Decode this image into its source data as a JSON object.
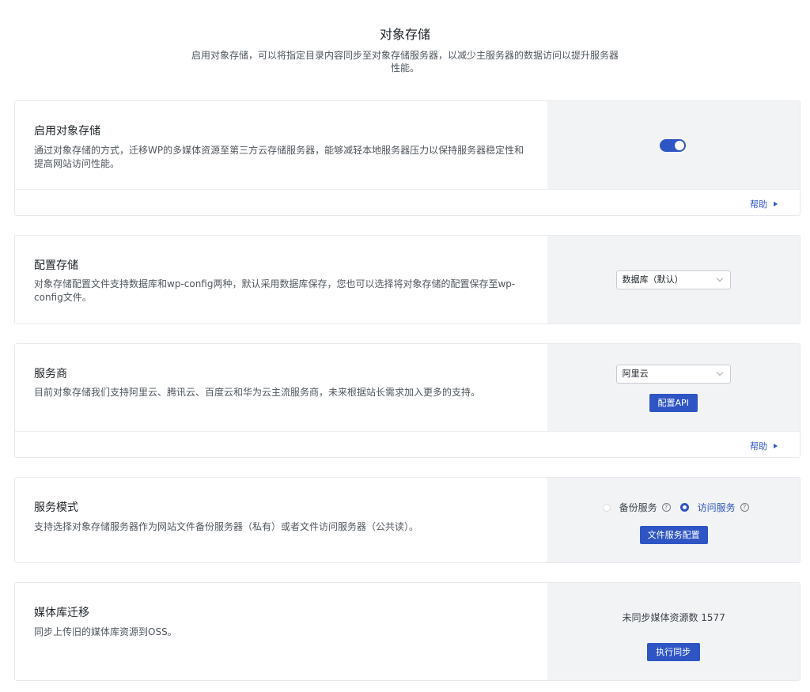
{
  "header": {
    "title": "对象存储",
    "description": "启用对象存储，可以将指定目录内容同步至对象存储服务器，以减少主服务器的数据访问以提升服务器性能。"
  },
  "sections": {
    "enable": {
      "title": "启用对象存储",
      "description": "通过对象存储的方式，迁移WP的多媒体资源至第三方云存储服务器，能够减轻本地服务器压力以保持服务器稳定性和提高网站访问性能。",
      "toggle_on": true,
      "help_label": "帮助"
    },
    "config": {
      "title": "配置存储",
      "description": "对象存储配置文件支持数据库和wp-config两种，默认采用数据库保存，您也可以选择将对象存储的配置保存至wp-config文件。",
      "select_value": "数据库（默认）"
    },
    "provider": {
      "title": "服务商",
      "description": "目前对象存储我们支持阿里云、腾讯云、百度云和华为云主流服务商，未来根据站长需求加入更多的支持。",
      "select_value": "阿里云",
      "button_label": "配置API",
      "help_label": "帮助"
    },
    "mode": {
      "title": "服务模式",
      "description": "支持选择对象存储服务器作为网站文件备份服务器（私有）或者文件访问服务器（公共读）。",
      "option_backup": "备份服务",
      "option_access": "访问服务",
      "selected": "访问服务",
      "button_label": "文件服务配置"
    },
    "migrate": {
      "title": "媒体库迁移",
      "description": "同步上传旧的媒体库资源到OSS。",
      "status_text": "未同步媒体资源数 1577",
      "button_label": "执行同步"
    }
  },
  "colors": {
    "accent": "#2f55c4",
    "panel_bg": "#f2f3f5",
    "border": "#e7e9ec"
  }
}
